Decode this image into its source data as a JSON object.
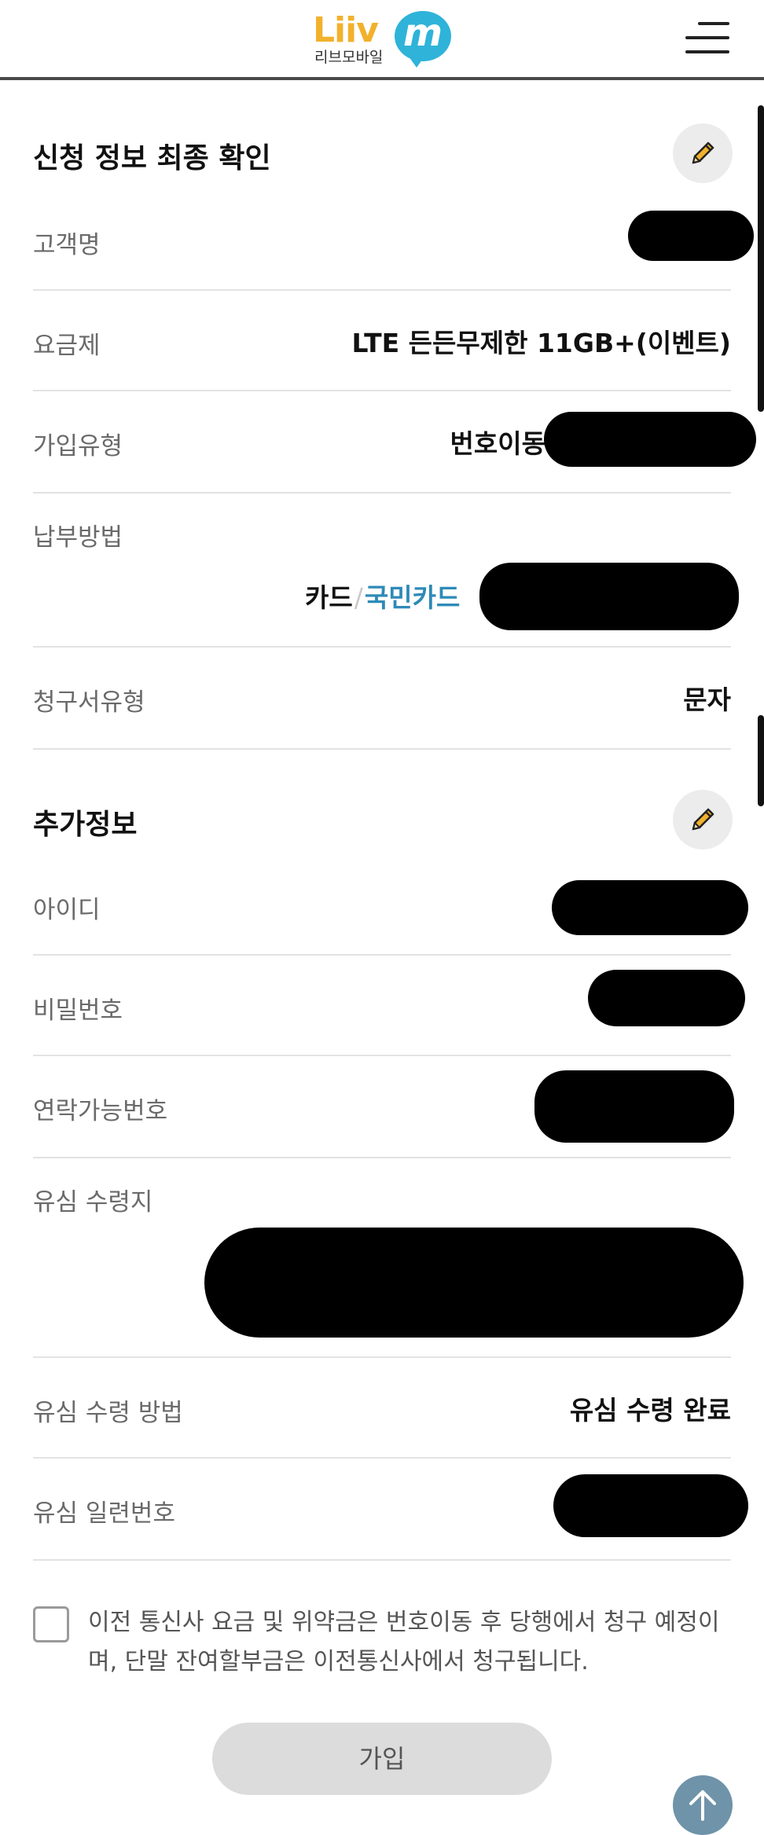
{
  "header": {
    "logo_word": "Liiv",
    "logo_letter": "m",
    "logo_sub": "리브모바일",
    "menu_icon": "hamburger-menu-icon"
  },
  "confirm": {
    "title": "신청 정보 최종 확인",
    "edit_icon": "pencil-icon",
    "rows": [
      {
        "label": "고객명",
        "value": ""
      },
      {
        "label": "요금제",
        "value": "LTE 든든무제한 11GB+(이벤트)"
      },
      {
        "label": "가입유형",
        "value": "번호이동"
      },
      {
        "label": "납부방법",
        "value_type": "카드",
        "value_sep": "/",
        "value_bank": "국민카드"
      },
      {
        "label": "청구서유형",
        "value": "문자"
      }
    ]
  },
  "extra": {
    "title": "추가정보",
    "edit_icon": "pencil-icon",
    "rows": [
      {
        "label": "아이디",
        "value": ""
      },
      {
        "label": "비밀번호",
        "value": ""
      },
      {
        "label": "연락가능번호",
        "value": ""
      },
      {
        "label": "유심 수령지",
        "value": ""
      },
      {
        "label": "유심 수령 방법",
        "value": "유심 수령 완료"
      },
      {
        "label": "유심 일련번호",
        "value": ""
      }
    ]
  },
  "consent": {
    "checked": false,
    "text": "이전 통신사 요금 및 위약금은 번호이동 후 당행에서 청구 예정이며, 단말 잔여할부금은 이전통신사에서 청구됩니다."
  },
  "join_button": {
    "label": "가입"
  },
  "scroll_top_icon": "arrow-up-icon",
  "colors": {
    "brand_yellow": "#f2b12c",
    "brand_blue": "#2fb3d9",
    "link_blue": "#2e8ab8",
    "button_gray": "#dcdcdc",
    "scroll_top_bg": "#6f93a8"
  }
}
